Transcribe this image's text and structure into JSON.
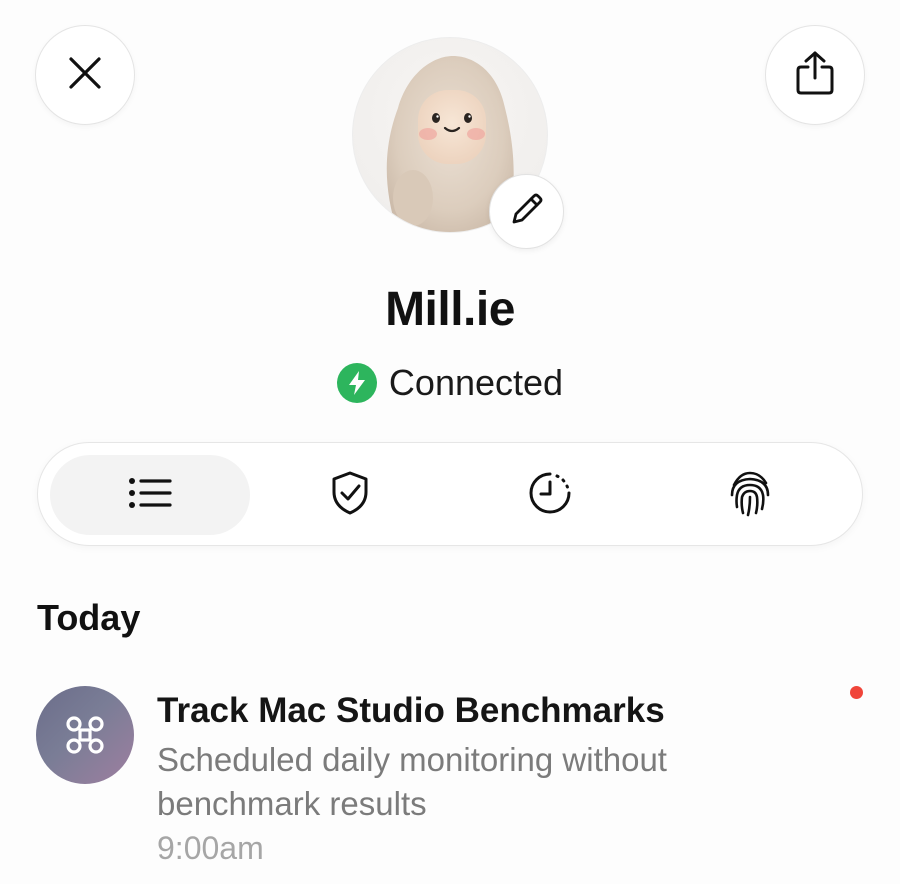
{
  "header": {
    "close_icon": "close-icon",
    "share_icon": "share-icon"
  },
  "profile": {
    "name": "Mill.ie",
    "avatar": "fluffy-creature-avatar",
    "edit_icon": "pencil-icon",
    "status": {
      "label": "Connected",
      "icon": "lightning-bolt-icon",
      "color": "#2db55d"
    }
  },
  "tabs": [
    {
      "icon": "list-icon",
      "active": true
    },
    {
      "icon": "shield-check-icon",
      "active": false
    },
    {
      "icon": "clock-history-icon",
      "active": false
    },
    {
      "icon": "fingerprint-icon",
      "active": false
    }
  ],
  "feed": {
    "section_title": "Today",
    "items": [
      {
        "icon": "command-key-icon",
        "title": "Track Mac Studio Benchmarks",
        "description": "Scheduled daily monitoring without benchmark results",
        "time": "9:00am",
        "unread": true,
        "unread_color": "#f0453a"
      }
    ]
  }
}
